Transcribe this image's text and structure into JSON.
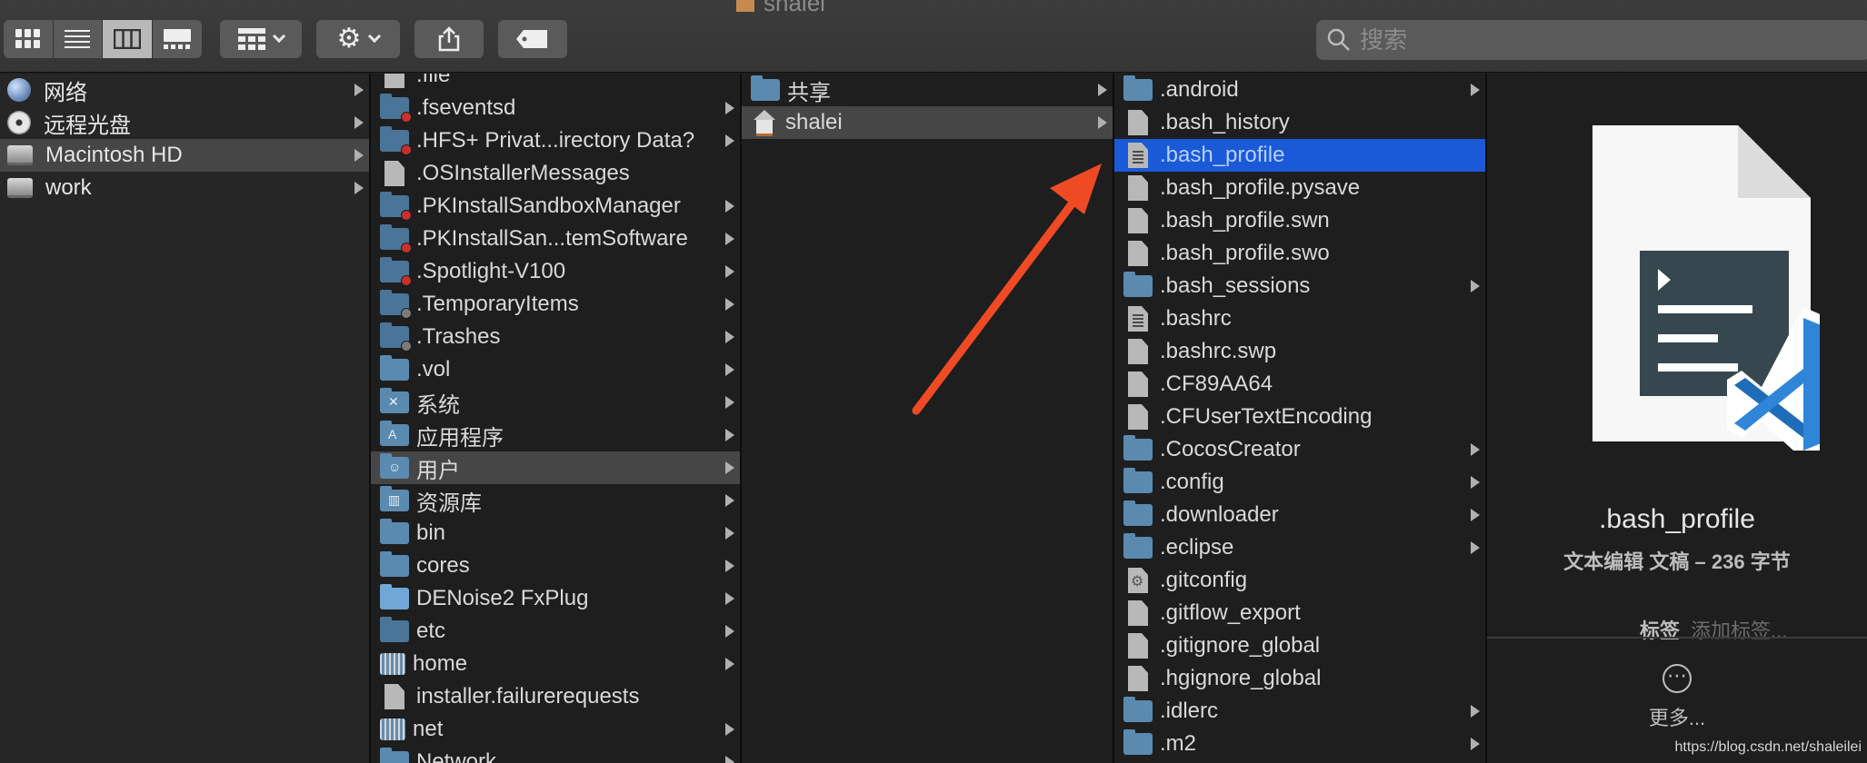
{
  "window": {
    "title_fragment": "shalei"
  },
  "toolbar": {
    "view_buttons": [
      "icon-view",
      "list-view",
      "column-view",
      "gallery-view"
    ],
    "selected_view": "column-view",
    "search_placeholder": "搜索"
  },
  "sidebar": {
    "items": [
      {
        "label": "网络",
        "icon": "network-globe-icon"
      },
      {
        "label": "远程光盘",
        "icon": "remote-disc-icon"
      },
      {
        "label": "Macintosh HD",
        "icon": "hard-drive-icon",
        "highlighted": true
      },
      {
        "label": "work",
        "icon": "hard-drive-icon"
      }
    ]
  },
  "column1": {
    "items": [
      {
        "label": ".file",
        "type": "file"
      },
      {
        "label": ".fseventsd",
        "type": "folder-restricted"
      },
      {
        "label": ".HFS+ Privat...irectory Data?",
        "type": "folder-restricted"
      },
      {
        "label": ".OSInstallerMessages",
        "type": "file"
      },
      {
        "label": ".PKInstallSandboxManager",
        "type": "folder-restricted"
      },
      {
        "label": ".PKInstallSan...temSoftware",
        "type": "folder-restricted"
      },
      {
        "label": ".Spotlight-V100",
        "type": "folder-restricted"
      },
      {
        "label": ".TemporaryItems",
        "type": "folder-locked"
      },
      {
        "label": ".Trashes",
        "type": "folder-locked"
      },
      {
        "label": ".vol",
        "type": "folder"
      },
      {
        "label": "系统",
        "type": "folder-system"
      },
      {
        "label": "应用程序",
        "type": "folder-apps"
      },
      {
        "label": "用户",
        "type": "folder-users",
        "highlighted": true
      },
      {
        "label": "资源库",
        "type": "folder-library"
      },
      {
        "label": "bin",
        "type": "folder"
      },
      {
        "label": "cores",
        "type": "folder"
      },
      {
        "label": "DENoise2 FxPlug",
        "type": "folder-bright"
      },
      {
        "label": "etc",
        "type": "folder-alias"
      },
      {
        "label": "home",
        "type": "volume"
      },
      {
        "label": "installer.failurerequests",
        "type": "file"
      },
      {
        "label": "net",
        "type": "volume"
      },
      {
        "label": "Network",
        "type": "folder"
      }
    ]
  },
  "column2": {
    "items": [
      {
        "label": "共享",
        "type": "folder"
      },
      {
        "label": "shalei",
        "type": "home",
        "highlighted": true
      }
    ]
  },
  "column3": {
    "items": [
      {
        "label": ".android",
        "type": "folder"
      },
      {
        "label": ".bash_history",
        "type": "file"
      },
      {
        "label": ".bash_profile",
        "type": "text",
        "selected": true
      },
      {
        "label": ".bash_profile.pysave",
        "type": "file"
      },
      {
        "label": ".bash_profile.swn",
        "type": "file"
      },
      {
        "label": ".bash_profile.swo",
        "type": "file"
      },
      {
        "label": ".bash_sessions",
        "type": "folder"
      },
      {
        "label": ".bashrc",
        "type": "text"
      },
      {
        "label": ".bashrc.swp",
        "type": "file"
      },
      {
        "label": ".CF89AA64",
        "type": "file"
      },
      {
        "label": ".CFUserTextEncoding",
        "type": "file"
      },
      {
        "label": ".CocosCreator",
        "type": "folder"
      },
      {
        "label": ".config",
        "type": "folder"
      },
      {
        "label": ".downloader",
        "type": "folder"
      },
      {
        "label": ".eclipse",
        "type": "folder"
      },
      {
        "label": ".gitconfig",
        "type": "config"
      },
      {
        "label": ".gitflow_export",
        "type": "file"
      },
      {
        "label": ".gitignore_global",
        "type": "file"
      },
      {
        "label": ".hgignore_global",
        "type": "file"
      },
      {
        "label": ".idlerc",
        "type": "folder"
      },
      {
        "label": ".m2",
        "type": "folder"
      }
    ]
  },
  "preview": {
    "icon": "vscode-document-icon",
    "name": ".bash_profile",
    "info": "文本编辑 文稿 – 236 字节",
    "tags_label": "标签",
    "tags_placeholder": "添加标签...",
    "more_label": "更多..."
  },
  "watermark": "https://blog.csdn.net/shaleilei",
  "colors": {
    "selection": "#1a5ad8",
    "arrow": "#f04a24",
    "folder": "#5b8ab0",
    "vscode_blue": "#2f86d8"
  }
}
